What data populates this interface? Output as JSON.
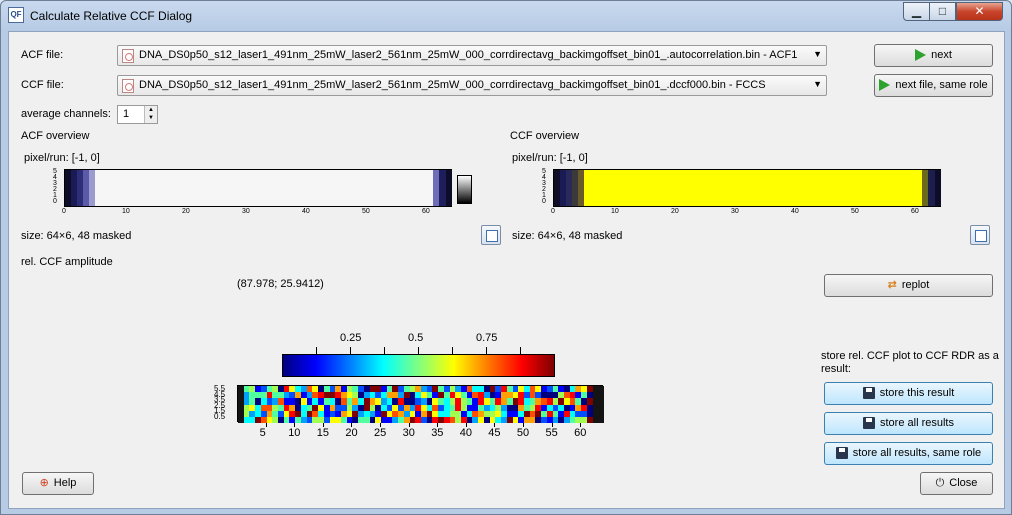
{
  "window": {
    "title": "Calculate Relative CCF Dialog",
    "icon_text": "QF",
    "controls": {
      "minimize": "▁",
      "maximize": "□",
      "close": "✕"
    }
  },
  "acf": {
    "label": "ACF file:",
    "value": "DNA_DS0p50_s12_laser1_491nm_25mW_laser2_561nm_25mW_000_corrdirectavg_backimgoffset_bin01_.autocorrelation.bin - ACF1"
  },
  "ccf": {
    "label": "CCF file:",
    "value": "DNA_DS0p50_s12_laser1_491nm_25mW_laser2_561nm_25mW_000_corrdirectavg_backimgoffset_bin01_.dccf000.bin - FCCS"
  },
  "buttons": {
    "next": "next",
    "next_same_role": "next file, same role",
    "replot": "replot",
    "store_this": "store this result",
    "store_all": "store all results",
    "store_all_same_role": "store all results, same role",
    "help": "Help",
    "close": "Close"
  },
  "average_channels": {
    "label": "average channels:",
    "value": "1"
  },
  "acf_overview": {
    "title": "ACF overview",
    "pixel_run": "pixel/run: [-1, 0]",
    "size": "size: 64×6, 48 masked",
    "x_ticks": [
      "0",
      "10",
      "20",
      "30",
      "40",
      "50",
      "60"
    ],
    "y_ticks": [
      "5",
      "4",
      "3",
      "2",
      "1",
      "0"
    ]
  },
  "ccf_overview": {
    "title": "CCF overview",
    "pixel_run": "pixel/run: [-1, 0]",
    "size": "size: 64×6, 48 masked",
    "x_ticks": [
      "0",
      "10",
      "20",
      "30",
      "40",
      "50",
      "60"
    ],
    "y_ticks": [
      "5",
      "4",
      "3",
      "2",
      "1",
      "0"
    ]
  },
  "rel_ccf": {
    "label": "rel. CCF amplitude",
    "coords": "(87.978; 25.9412)",
    "colorbar_ticks": [
      "0.25",
      "0.5",
      "0.75"
    ],
    "x_ticks": [
      "5",
      "10",
      "15",
      "20",
      "25",
      "30",
      "35",
      "40",
      "45",
      "50",
      "55",
      "60"
    ],
    "y_ticks": [
      "5.5",
      "4.5",
      "3.5",
      "2.5",
      "1.5",
      "0.5"
    ]
  },
  "store_label": "store rel. CCF plot to CCF RDR as a result:",
  "colors": {
    "ccf_yellow": "#ffff00",
    "acf_white": "#f6f6f6",
    "masked_dark": "#0d0d2a",
    "button_blue": "#bee6fd"
  }
}
